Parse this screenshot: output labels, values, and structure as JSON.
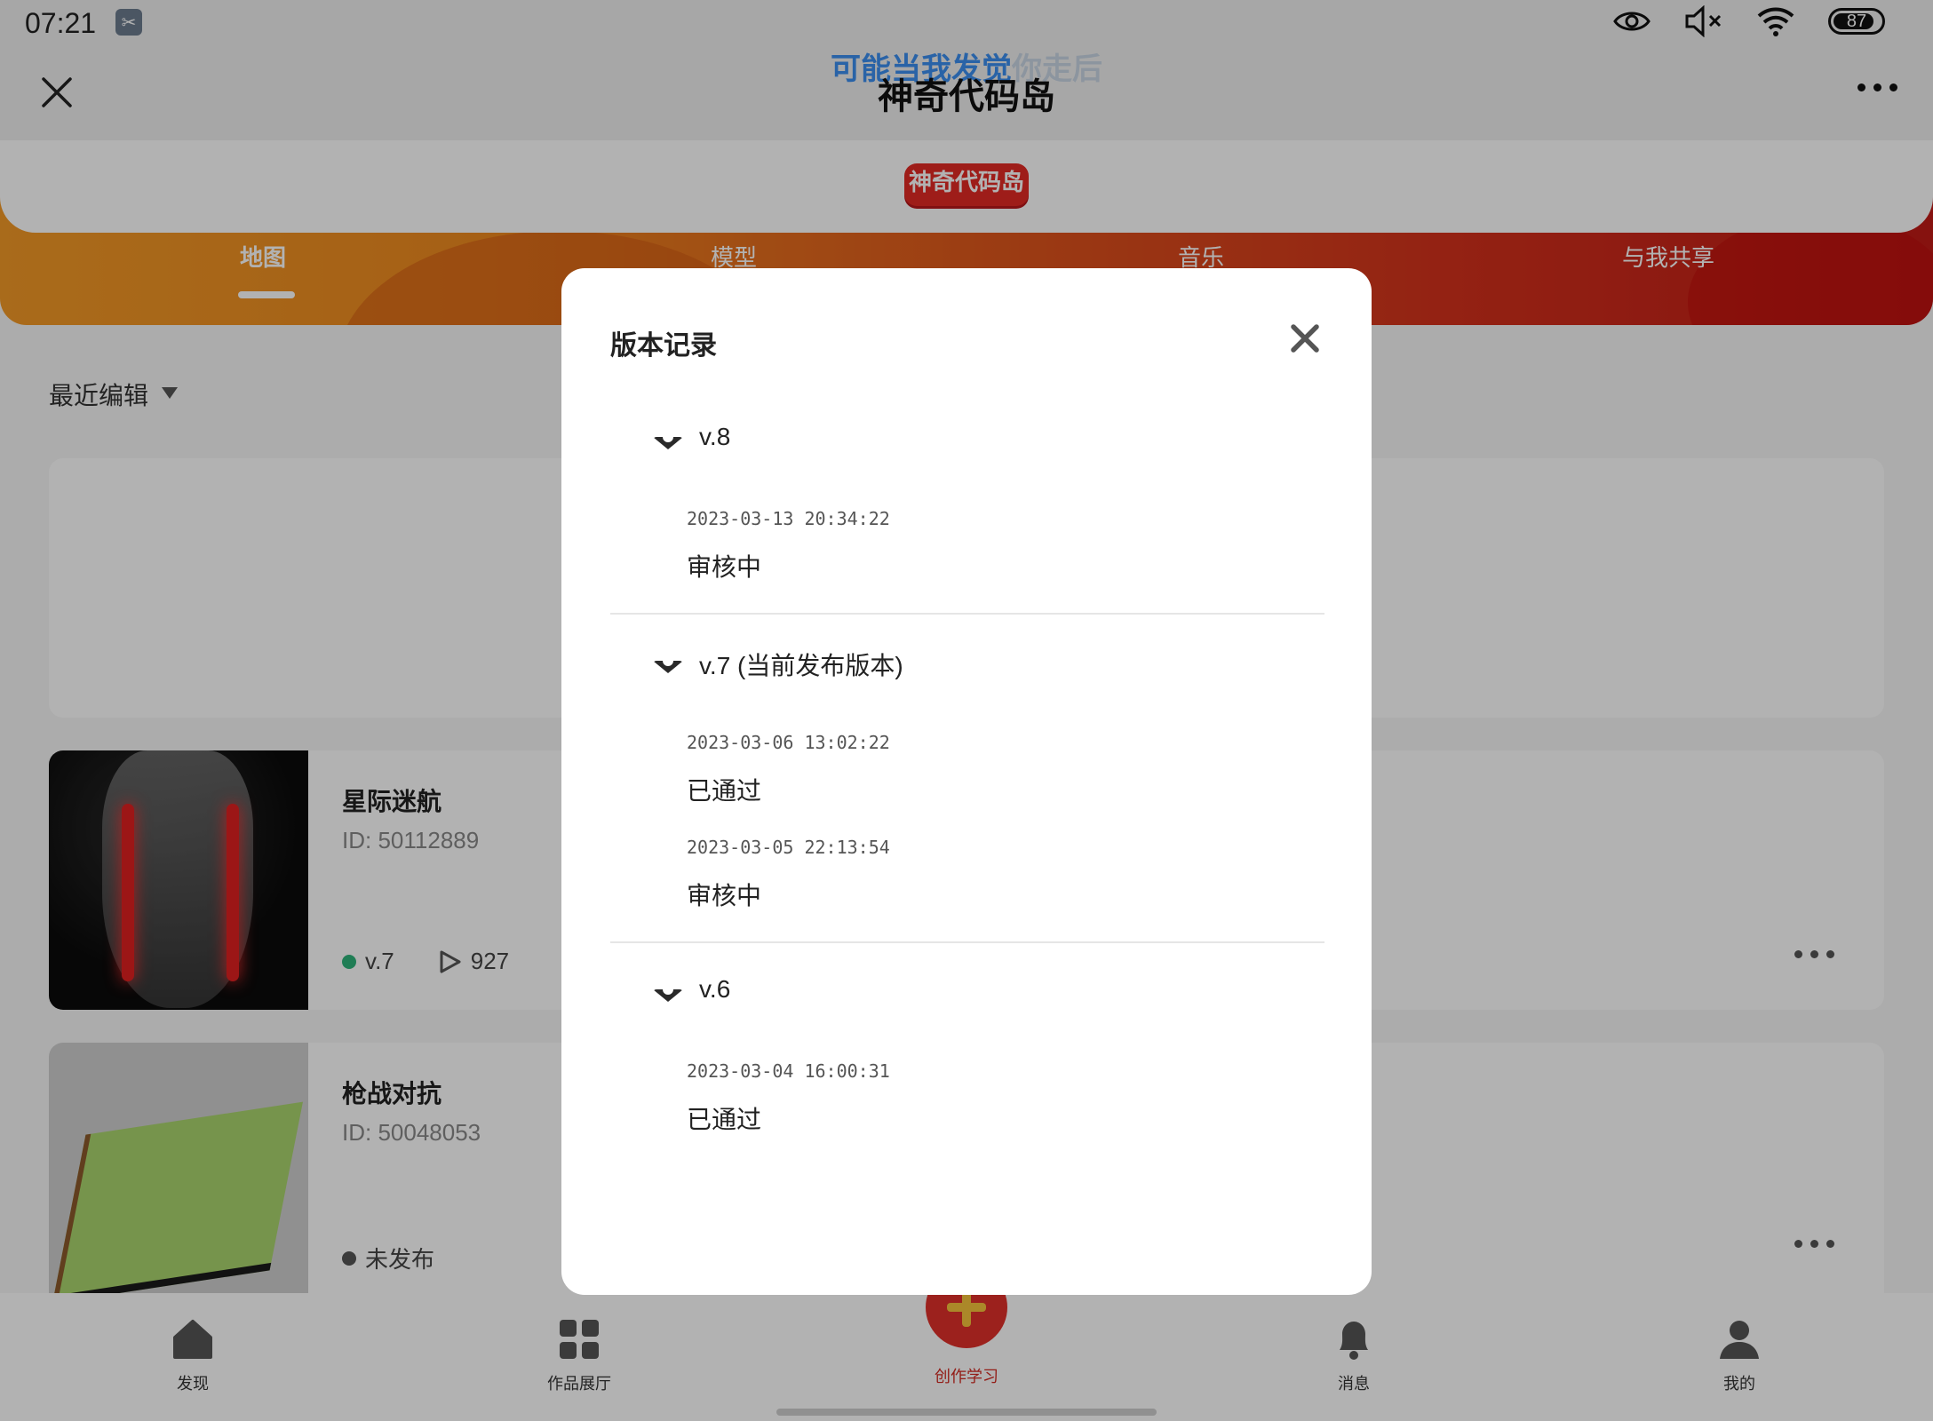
{
  "status_bar": {
    "time": "07:21",
    "app_icon": "scissors-icon",
    "icons": [
      "eye-icon",
      "volume-muted-icon",
      "wifi-icon",
      "battery-icon"
    ],
    "battery_level": "87"
  },
  "header": {
    "title": "神奇代码岛",
    "lyric_highlight": "可能当我发觉",
    "lyric_rest": "你走后",
    "close_icon": "close-icon",
    "more_icon": "more-icon"
  },
  "banner": {
    "logo_text": "神奇代码岛",
    "tabs": [
      {
        "label": "地图",
        "active": true
      },
      {
        "label": "模型",
        "active": false
      },
      {
        "label": "音乐",
        "active": false
      },
      {
        "label": "与我共享",
        "active": false
      }
    ]
  },
  "list": {
    "sort_label": "最近编辑",
    "works": [
      {
        "title": "星际迷航",
        "id": "ID: 50112889",
        "version": "v.7",
        "play_count": "927",
        "status_color": "#2fb37a"
      },
      {
        "title": "枪战对抗",
        "id": "ID: 50048053",
        "status": "未发布",
        "status_color": "#555555"
      }
    ]
  },
  "bottom_nav": [
    {
      "label": "发现",
      "icon": "home-icon"
    },
    {
      "label": "作品展厅",
      "icon": "grid-icon"
    },
    {
      "label": "创作学习",
      "icon": "plus-icon",
      "active": true
    },
    {
      "label": "消息",
      "icon": "bell-icon"
    },
    {
      "label": "我的",
      "icon": "user-icon"
    }
  ],
  "dialog": {
    "title": "版本记录",
    "versions": [
      {
        "label": "v.8",
        "records": [
          {
            "time": "2023-03-13 20:34:22",
            "status": "审核中"
          }
        ]
      },
      {
        "label": "v.7 (当前发布版本)",
        "records": [
          {
            "time": "2023-03-06 13:02:22",
            "status": "已通过"
          },
          {
            "time": "2023-03-05 22:13:54",
            "status": "审核中"
          }
        ]
      },
      {
        "label": "v.6",
        "records": [
          {
            "time": "2023-03-04 16:00:31",
            "status": "已通过"
          }
        ]
      }
    ]
  },
  "colors": {
    "accent_red": "#d32a22",
    "banner_orange": "#ee8a1f",
    "published_green": "#2fb37a"
  }
}
